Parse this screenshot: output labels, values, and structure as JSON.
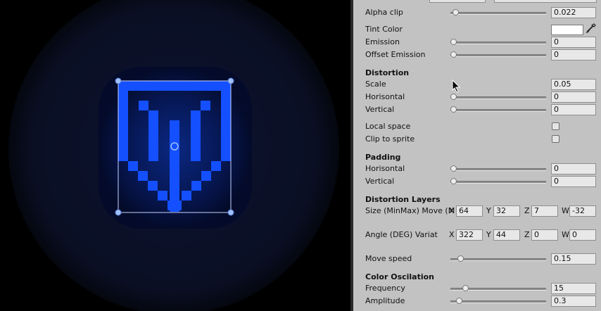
{
  "inspector": {
    "alpha_clip": {
      "label": "Alpha clip",
      "value": "0.022",
      "level": 0.022
    },
    "tint_color": {
      "label": "Tint Color",
      "color": "#ffffff",
      "icon": "eyedropper-icon"
    },
    "emission": {
      "label": "Emission",
      "value": "0",
      "level": 0
    },
    "offset_emission": {
      "label": "Offset Emission",
      "value": "0",
      "level": 0
    },
    "distortion": {
      "header": "Distortion",
      "scale": {
        "label": "Scale",
        "value": "0.05",
        "level": 0.05
      },
      "horisontal": {
        "label": "Horisontal",
        "value": "0",
        "level": 0
      },
      "vertical": {
        "label": "Vertical",
        "value": "0",
        "level": 0
      }
    },
    "local_space": {
      "label": "Local space",
      "checked": false
    },
    "clip_to_sprite": {
      "label": "Clip to sprite",
      "checked": false
    },
    "padding": {
      "header": "Padding",
      "horisontal": {
        "label": "Horisontal",
        "value": "0",
        "level": 0
      },
      "vertical": {
        "label": "Vertical",
        "value": "0",
        "level": 0
      }
    },
    "distortion_layers": {
      "header": "Distortion Layers",
      "size_move": {
        "label": "Size (MinMax) Move (M",
        "x": "64",
        "y": "32",
        "z": "7",
        "w": "-32"
      },
      "angle": {
        "label": "Angle (DEG) Variat",
        "x": "322",
        "y": "44",
        "z": "0",
        "w": "0"
      },
      "axis_labels": {
        "x": "X",
        "y": "Y",
        "z": "Z",
        "w": "W"
      }
    },
    "move_speed": {
      "label": "Move speed",
      "value": "0.15",
      "level": 0.08
    },
    "color_oscilation": {
      "header": "Color Oscilation",
      "frequency": {
        "label": "Frequency",
        "value": "15",
        "level": 0.13
      },
      "amplitude": {
        "label": "Amplitude",
        "value": "0.3",
        "level": 0.06
      }
    }
  },
  "scene": {
    "sprite_color": "#1450ff",
    "glow_color": "#0a1030",
    "handle_color": "#9ec0ff"
  }
}
